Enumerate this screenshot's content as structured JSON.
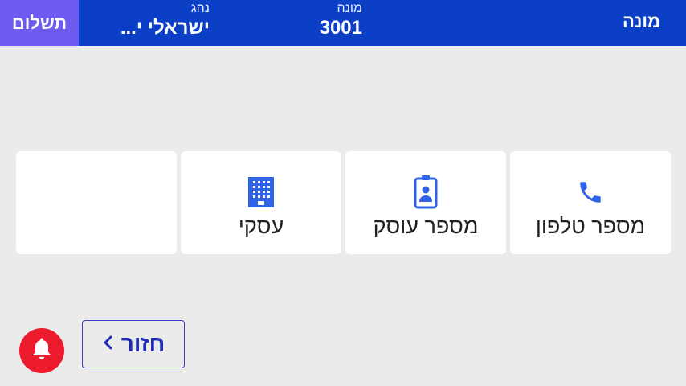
{
  "header": {
    "pay_label": "תשלום",
    "driver_label": "נהג",
    "driver_value": "ישראלי י...",
    "meter_label": "מונה",
    "meter_value": "3001",
    "title": "מונה"
  },
  "options": [
    {
      "label": "מספר טלפון",
      "icon": "phone-icon"
    },
    {
      "label": "מספר עוסק",
      "icon": "id-badge-icon"
    },
    {
      "label": "עסקי",
      "icon": "building-icon"
    },
    {
      "label": ""
    }
  ],
  "footer": {
    "back_label": "חזור",
    "back_icon": "chevron-left-icon",
    "bell_icon": "bell-icon"
  },
  "colors": {
    "header_bg": "#0b3fc6",
    "pay_bg": "#6e5cf1",
    "icon_blue": "#2f63e6",
    "bell_red": "#ec1c2e",
    "back_border": "#3a40c8"
  }
}
